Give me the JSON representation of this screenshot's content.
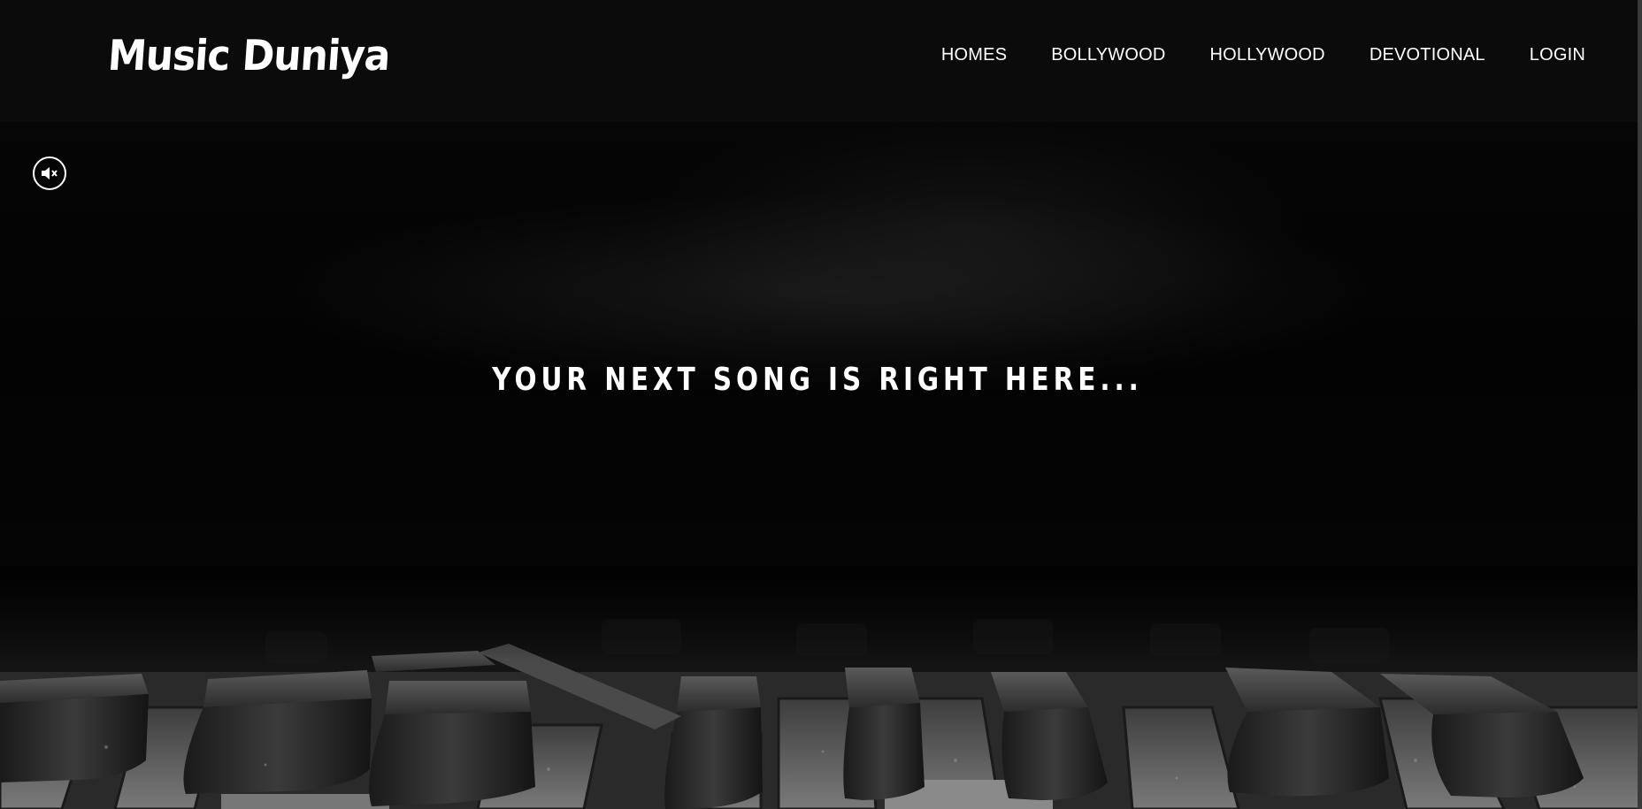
{
  "brand": {
    "name": "Music Duniya"
  },
  "nav": {
    "items": [
      {
        "label": "HOMES"
      },
      {
        "label": "BOLLYWOOD"
      },
      {
        "label": "HOLLYWOOD"
      },
      {
        "label": "DEVOTIONAL"
      },
      {
        "label": "LOGIN"
      }
    ]
  },
  "hero": {
    "tagline": "YOUR NEXT SONG IS RIGHT HERE...",
    "background": "piano-keys-image",
    "mute_icon": "speaker-muted-icon"
  },
  "colors": {
    "header_bg": "#0b0b0b",
    "text": "#ffffff",
    "background": "#040404"
  }
}
